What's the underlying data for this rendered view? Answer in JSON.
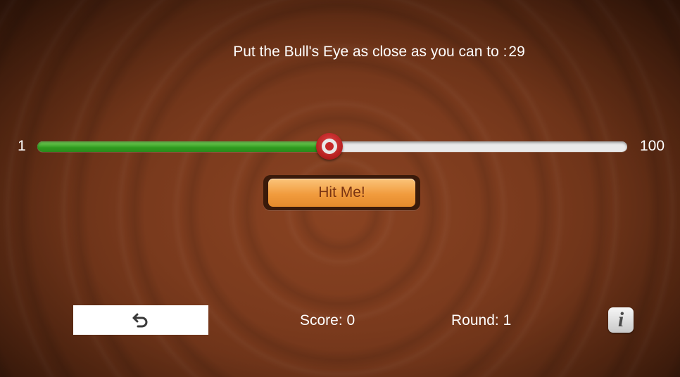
{
  "prompt": {
    "text": "Put the Bull's Eye as close as you can to :",
    "target_value": "29"
  },
  "slider": {
    "min_label": "1",
    "max_label": "100",
    "value": 50,
    "min": 1,
    "max": 100
  },
  "hit_button": {
    "label": "Hit Me!"
  },
  "reset_button": {
    "icon": "undo-arrow-icon"
  },
  "score": {
    "label": "Score:",
    "value": "0"
  },
  "round": {
    "label": "Round:",
    "value": "1"
  },
  "info_button": {
    "label": "i",
    "icon": "info-icon"
  },
  "colors": {
    "slider_fill": "#2f9a1f",
    "slider_track": "#e9e9e9",
    "thumb": "#c62828",
    "button": "#f19c3e",
    "button_text": "#7a3412"
  }
}
